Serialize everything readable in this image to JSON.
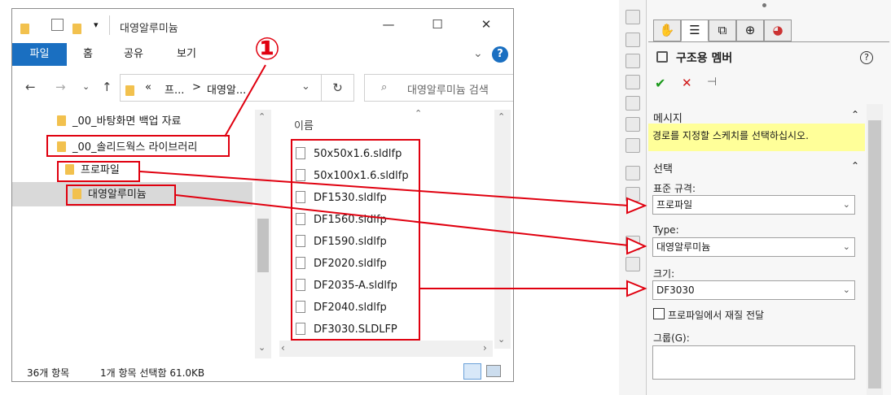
{
  "explorer": {
    "title": "대영알루미늄",
    "quick_access_arrow": "▾",
    "ribbon": {
      "file": "파일",
      "home": "홈",
      "share": "공유",
      "view": "보기"
    },
    "address": {
      "prefix": "«",
      "crumb1": "프...",
      "crumb2": "대영알..."
    },
    "search_placeholder": "대영알루미늄 검색",
    "tree": [
      "_00_바탕화면 백업 자료",
      "_00_솔리드웍스 라이브러리",
      "프로파일",
      "대영알루미늄"
    ],
    "column_header": "이름",
    "files": [
      "50x50x1.6.sldlfp",
      "50x100x1.6.sldlfp",
      "DF1530.sldlfp",
      "DF1560.sldlfp",
      "DF1590.sldlfp",
      "DF2020.sldlfp",
      "DF2035-A.sldlfp",
      "DF2040.sldlfp",
      "DF3030.SLDLFP"
    ],
    "status_count": "36개 항목",
    "status_selected": "1개 항목 선택함 61.0KB"
  },
  "annotation_marker": "①",
  "solidworks": {
    "feature_title": "구조용 멤버",
    "ok": "✔",
    "cancel": "✕",
    "pin": "⊣",
    "message_section": "메시지",
    "message_text": "경로를 지정할 스케치를 선택하십시오.",
    "selection_section": "선택",
    "standard_label": "표준 규격:",
    "standard_value": "프로파일",
    "type_label": "Type:",
    "type_value": "대영알루미늄",
    "size_label": "크기:",
    "size_value": "DF3030",
    "transfer_label": "프로파일에서 재질 전달",
    "group_label": "그룹(G):",
    "help": "?"
  },
  "colors": {
    "accent_blue": "#1a6fc1",
    "annotation_red": "#e0000f",
    "hint_yellow": "#ffff99"
  }
}
